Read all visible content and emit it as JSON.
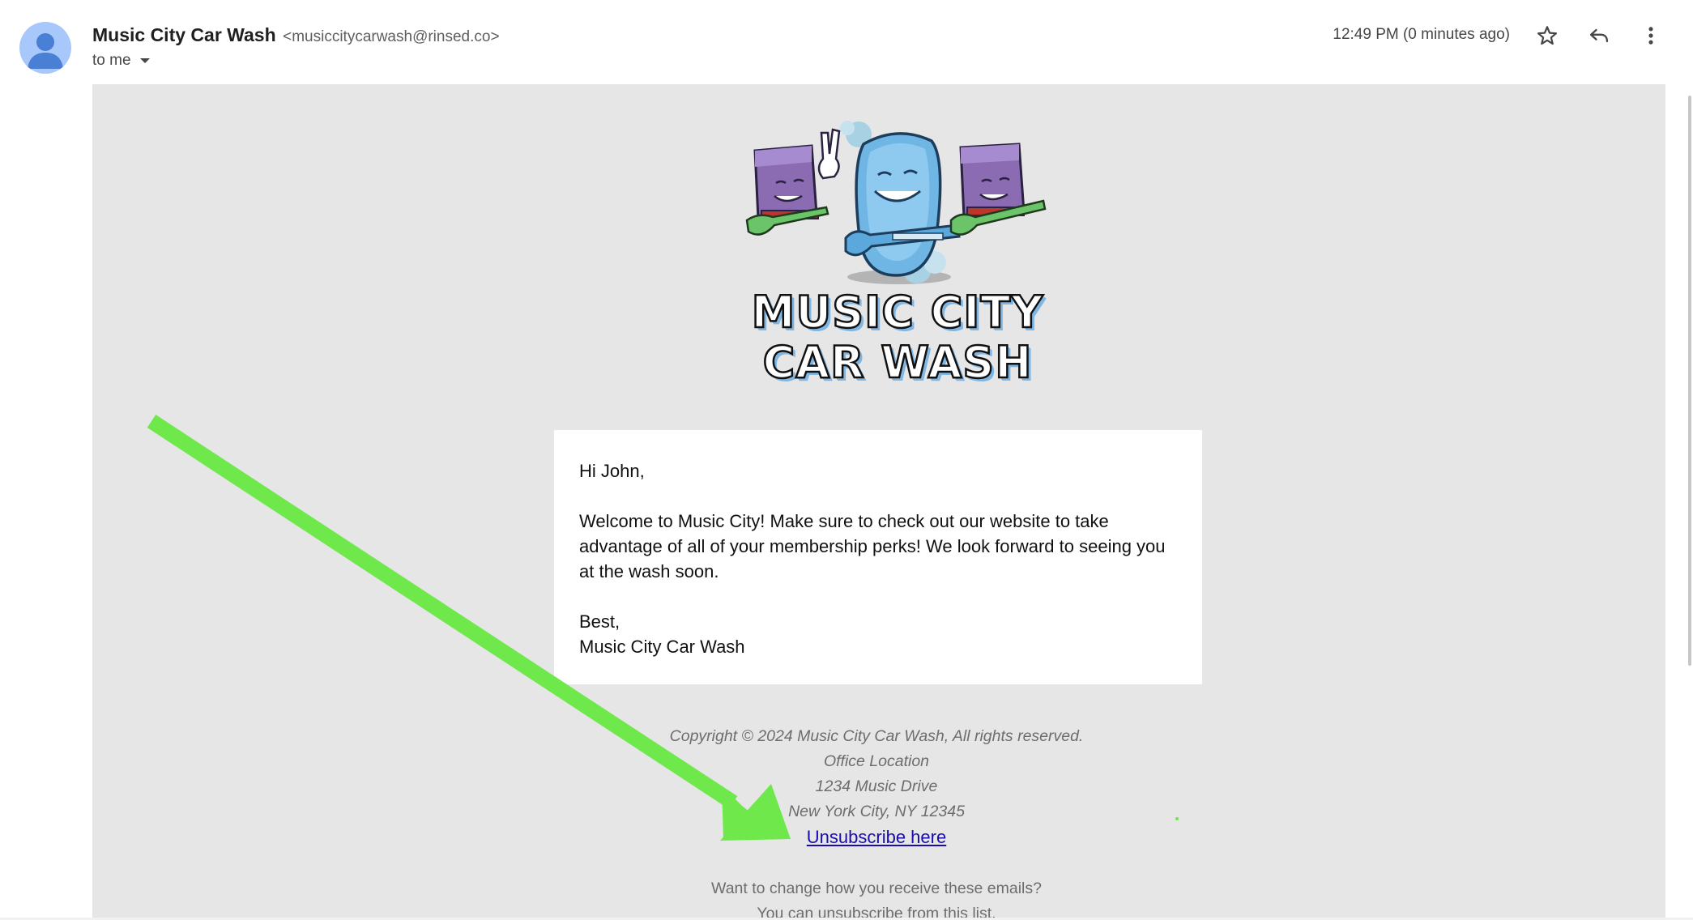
{
  "header": {
    "sender_name": "Music City Car Wash",
    "sender_email": "<musiccitycarwash@rinsed.co>",
    "recipient": "to me",
    "timestamp": "12:49 PM (0 minutes ago)",
    "icons": {
      "avatar": "person-avatar-icon",
      "details": "chevron-down-icon",
      "star": "star-icon",
      "reply": "reply-icon",
      "more": "more-vert-icon"
    }
  },
  "email": {
    "logo_text_line1": "MUSIC CITY",
    "logo_text_line2": "CAR WASH",
    "greeting": "Hi John,",
    "body": "Welcome to Music City! Make sure to check out our website to take advantage of all of your membership perks! We look forward to seeing you at the wash soon.",
    "signoff": "Best,",
    "signature": "Music City Car Wash",
    "footer": {
      "copyright": "Copyright © 2024 Music City Car Wash, All rights reserved.",
      "office_label": "Office Location",
      "address_line1": "1234 Music Drive",
      "address_line2": "New York City, NY 12345",
      "unsubscribe_label": "Unsubscribe here",
      "preferences_question": "Want to change how you receive these emails?",
      "preferences_text": "You can unsubscribe from this list."
    }
  },
  "colors": {
    "email_background": "#e6e6e6",
    "link": "#1a0dab",
    "annotation_arrow": "#6ee84a",
    "avatar": "#a8c7fa"
  }
}
